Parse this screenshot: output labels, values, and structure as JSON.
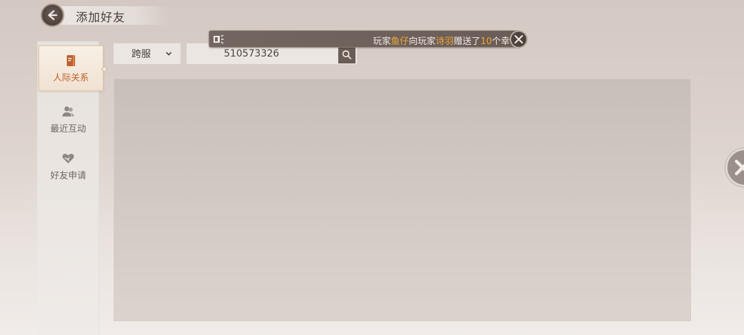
{
  "header": {
    "title": "添加好友"
  },
  "sidebar": {
    "items": [
      {
        "label": "人际关系",
        "icon": "book-icon",
        "active": true
      },
      {
        "label": "最近互动",
        "icon": "people-icon",
        "active": false
      },
      {
        "label": "好友申请",
        "icon": "heart-hands-icon",
        "active": false
      }
    ]
  },
  "controls": {
    "server_select": {
      "value": "跨服"
    },
    "search": {
      "value": "510573326"
    }
  },
  "broadcast": {
    "segments": [
      "玩家",
      "鱼仔",
      "向玩家",
      "诗羽",
      "赠送了",
      "10",
      "个幸"
    ]
  },
  "colors": {
    "accent": "#c0612f",
    "highlight": "#f0a838",
    "banner_bg": "#6a5d57"
  }
}
